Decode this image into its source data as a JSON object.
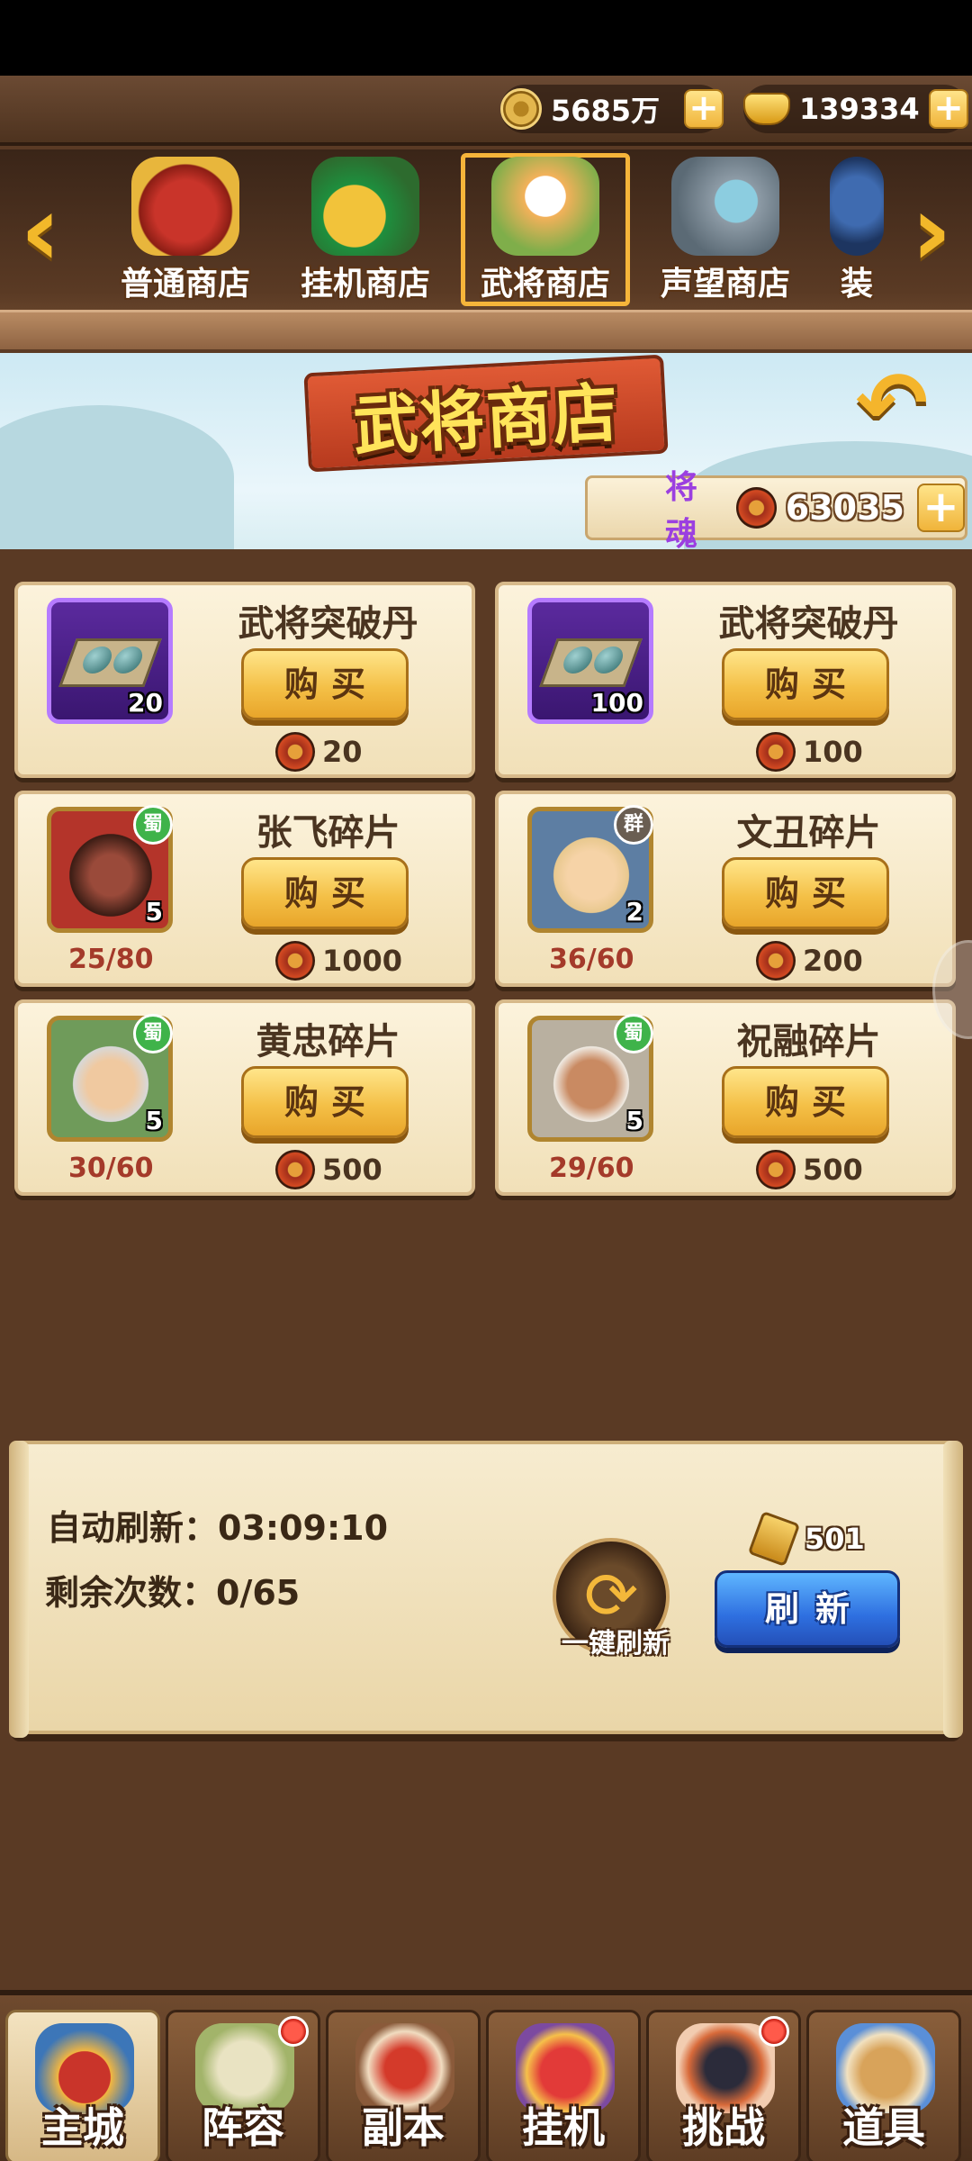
{
  "currencies": {
    "copper": {
      "value": "5685万",
      "icon": "copper-coin-icon"
    },
    "ingot": {
      "value": "139334",
      "icon": "gold-ingot-icon"
    },
    "plus": "+"
  },
  "shop_tabs": [
    {
      "label": "普通商店",
      "icon": "treasure-chest-icon",
      "active": false
    },
    {
      "label": "挂机商店",
      "icon": "idle-coin-icon",
      "active": false
    },
    {
      "label": "武将商店",
      "icon": "hero-icon",
      "active": true
    },
    {
      "label": "声望商店",
      "icon": "prestige-icon",
      "active": false
    },
    {
      "label": "装",
      "icon": "equipment-icon",
      "active": false
    }
  ],
  "nav_arrows": {
    "left": "‹",
    "right": "›"
  },
  "header": {
    "title": "武将商店",
    "back": "↶",
    "soul_label": "将魂",
    "soul_value": "63035",
    "soul_plus": "+"
  },
  "items": [
    {
      "name": "武将突破丹",
      "qty": "20",
      "buy": "购买",
      "price": "20",
      "type": "pill"
    },
    {
      "name": "武将突破丹",
      "qty": "100",
      "buy": "购买",
      "price": "100",
      "type": "pill"
    },
    {
      "name": "张飞碎片",
      "qty": "5",
      "badge": "蜀",
      "progress": "25/80",
      "buy": "购买",
      "price": "1000",
      "type": "hero"
    },
    {
      "name": "文丑碎片",
      "qty": "2",
      "badge": "群",
      "progress": "36/60",
      "buy": "购买",
      "price": "200",
      "type": "hero"
    },
    {
      "name": "黄忠碎片",
      "qty": "5",
      "badge": "蜀",
      "progress": "30/60",
      "buy": "购买",
      "price": "500",
      "type": "hero"
    },
    {
      "name": "祝融碎片",
      "qty": "5",
      "badge": "蜀",
      "progress": "29/60",
      "buy": "购买",
      "price": "500",
      "type": "hero"
    }
  ],
  "refresh_panel": {
    "auto_label": "自动刷新：03:09:10",
    "remain_label": "剩余次数：0/65",
    "onekey_label": "一键刷新",
    "onekey_icon": "⟳",
    "token_value": "501",
    "refresh_button": "刷新"
  },
  "bottom_nav": [
    {
      "label": "主城",
      "active": true,
      "dot": false
    },
    {
      "label": "阵容",
      "active": false,
      "dot": true
    },
    {
      "label": "副本",
      "active": false,
      "dot": false
    },
    {
      "label": "挂机",
      "active": false,
      "dot": false
    },
    {
      "label": "挑战",
      "active": false,
      "dot": true
    },
    {
      "label": "道具",
      "active": false,
      "dot": false
    }
  ]
}
